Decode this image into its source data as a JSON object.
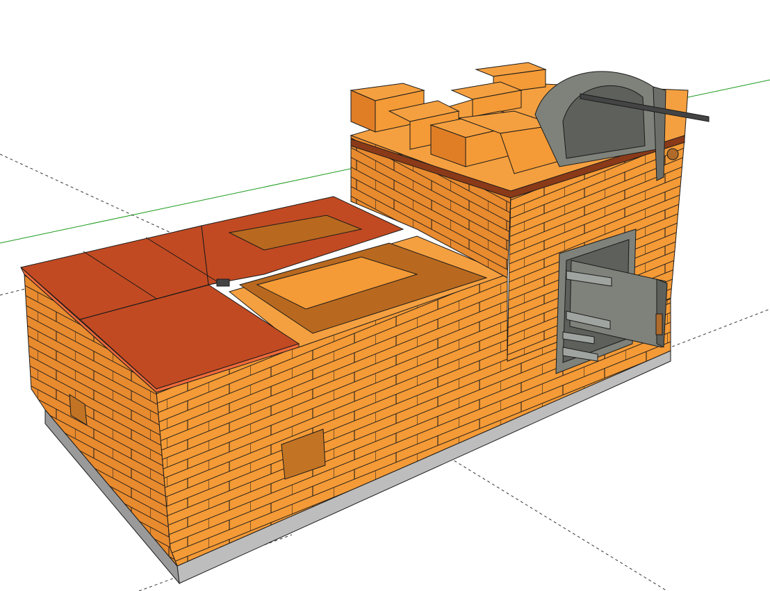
{
  "viewport": {
    "background": "#ffffff",
    "green_axis_color": "#1a9a1a",
    "guide_color": "#333333"
  },
  "model": {
    "subject": "brick-stove-with-hob-and-oven",
    "colors": {
      "brick_top": "#f5a040",
      "brick_front": "#f49a36",
      "brick_side": "#e07e26",
      "brick_shadow": "#b8691f",
      "hob_plate": "#c24a22",
      "hob_plate_edge": "#f06a3a",
      "hob_rim": "#b43c1e",
      "base_plinth": "#bdbdbd",
      "base_plinth_dark": "#9a9a9a",
      "iron_door": "#7e827a",
      "iron_door_dark": "#5d605b",
      "iron_hinge": "#a0a4a0",
      "handle_wood": "#b06a2a",
      "mortar_line": "#1a1a1a"
    },
    "icons": {
      "furnace_door": "cast-iron-furnace-door-icon",
      "oven_door": "arched-oven-door-icon",
      "hob": "cooking-plate-icon",
      "ash_opening": "cleanout-opening-icon"
    }
  }
}
